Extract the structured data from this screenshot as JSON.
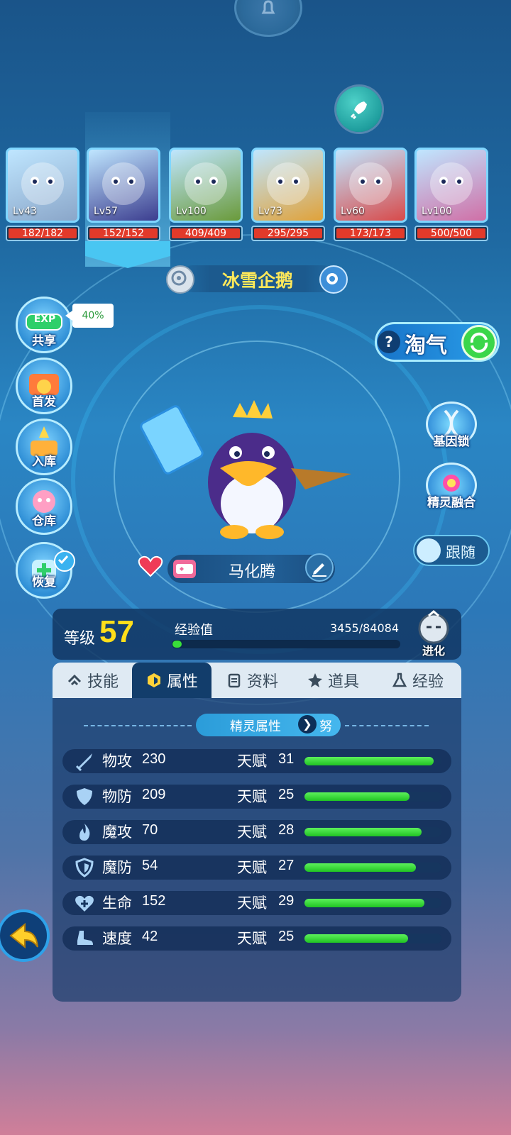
{
  "team": [
    {
      "level": "Lv43",
      "hp": "182/182",
      "hp_fraction": 1.0
    },
    {
      "level": "Lv57",
      "hp": "152/152",
      "hp_fraction": 1.0
    },
    {
      "level": "Lv100",
      "hp": "409/409",
      "hp_fraction": 1.0
    },
    {
      "level": "Lv73",
      "hp": "295/295",
      "hp_fraction": 1.0
    },
    {
      "level": "Lv60",
      "hp": "173/173",
      "hp_fraction": 1.0
    },
    {
      "level": "Lv100",
      "hp": "500/500",
      "hp_fraction": 1.0
    }
  ],
  "pet_name": "冰雪企鹅",
  "left_menu": {
    "exp_share": {
      "label": "共享",
      "badge": "EXP",
      "tip": "40%"
    },
    "first": {
      "label": "首发"
    },
    "storage_in": {
      "label": "入库"
    },
    "warehouse": {
      "label": "仓库"
    },
    "recover": {
      "label": "恢复"
    }
  },
  "right_menu": {
    "taoqi": {
      "help": "?",
      "label": "淘气"
    },
    "gene_lock": {
      "label": "基因锁"
    },
    "fusion": {
      "label": "精灵融合"
    },
    "follow": {
      "label": "跟随"
    }
  },
  "nickname": "马化腾",
  "level": {
    "label": "等级",
    "value": "57"
  },
  "exp": {
    "label": "经验值",
    "value": "3455/84084",
    "fraction": 0.041
  },
  "evolve_label": "进化",
  "tabs": [
    {
      "label": "技能",
      "icon": "skill-icon"
    },
    {
      "label": "属性",
      "icon": "attribute-icon",
      "active": true
    },
    {
      "label": "资料",
      "icon": "document-icon"
    },
    {
      "label": "道具",
      "icon": "item-icon"
    },
    {
      "label": "经验",
      "icon": "flask-icon"
    }
  ],
  "section": {
    "title": "精灵属性",
    "extra": "努"
  },
  "talent_label": "天赋",
  "stats": [
    {
      "name": "物攻",
      "value": "230",
      "talent": "31",
      "fraction": 0.95,
      "icon": "sword-icon"
    },
    {
      "name": "物防",
      "value": "209",
      "talent": "25",
      "fraction": 0.77,
      "icon": "shield-icon"
    },
    {
      "name": "魔攻",
      "value": "70",
      "talent": "28",
      "fraction": 0.86,
      "icon": "flame-icon"
    },
    {
      "name": "魔防",
      "value": "54",
      "talent": "27",
      "fraction": 0.82,
      "icon": "magic-shield-icon"
    },
    {
      "name": "生命",
      "value": "152",
      "talent": "29",
      "fraction": 0.88,
      "icon": "heart-plus-icon"
    },
    {
      "name": "速度",
      "value": "42",
      "talent": "25",
      "fraction": 0.76,
      "icon": "boot-icon"
    }
  ],
  "colors": {
    "hp": "#e23a2a",
    "exp": "#39e03a",
    "talent": "#21c323",
    "name": "#ffe85a",
    "level": "#ffdf1a"
  }
}
